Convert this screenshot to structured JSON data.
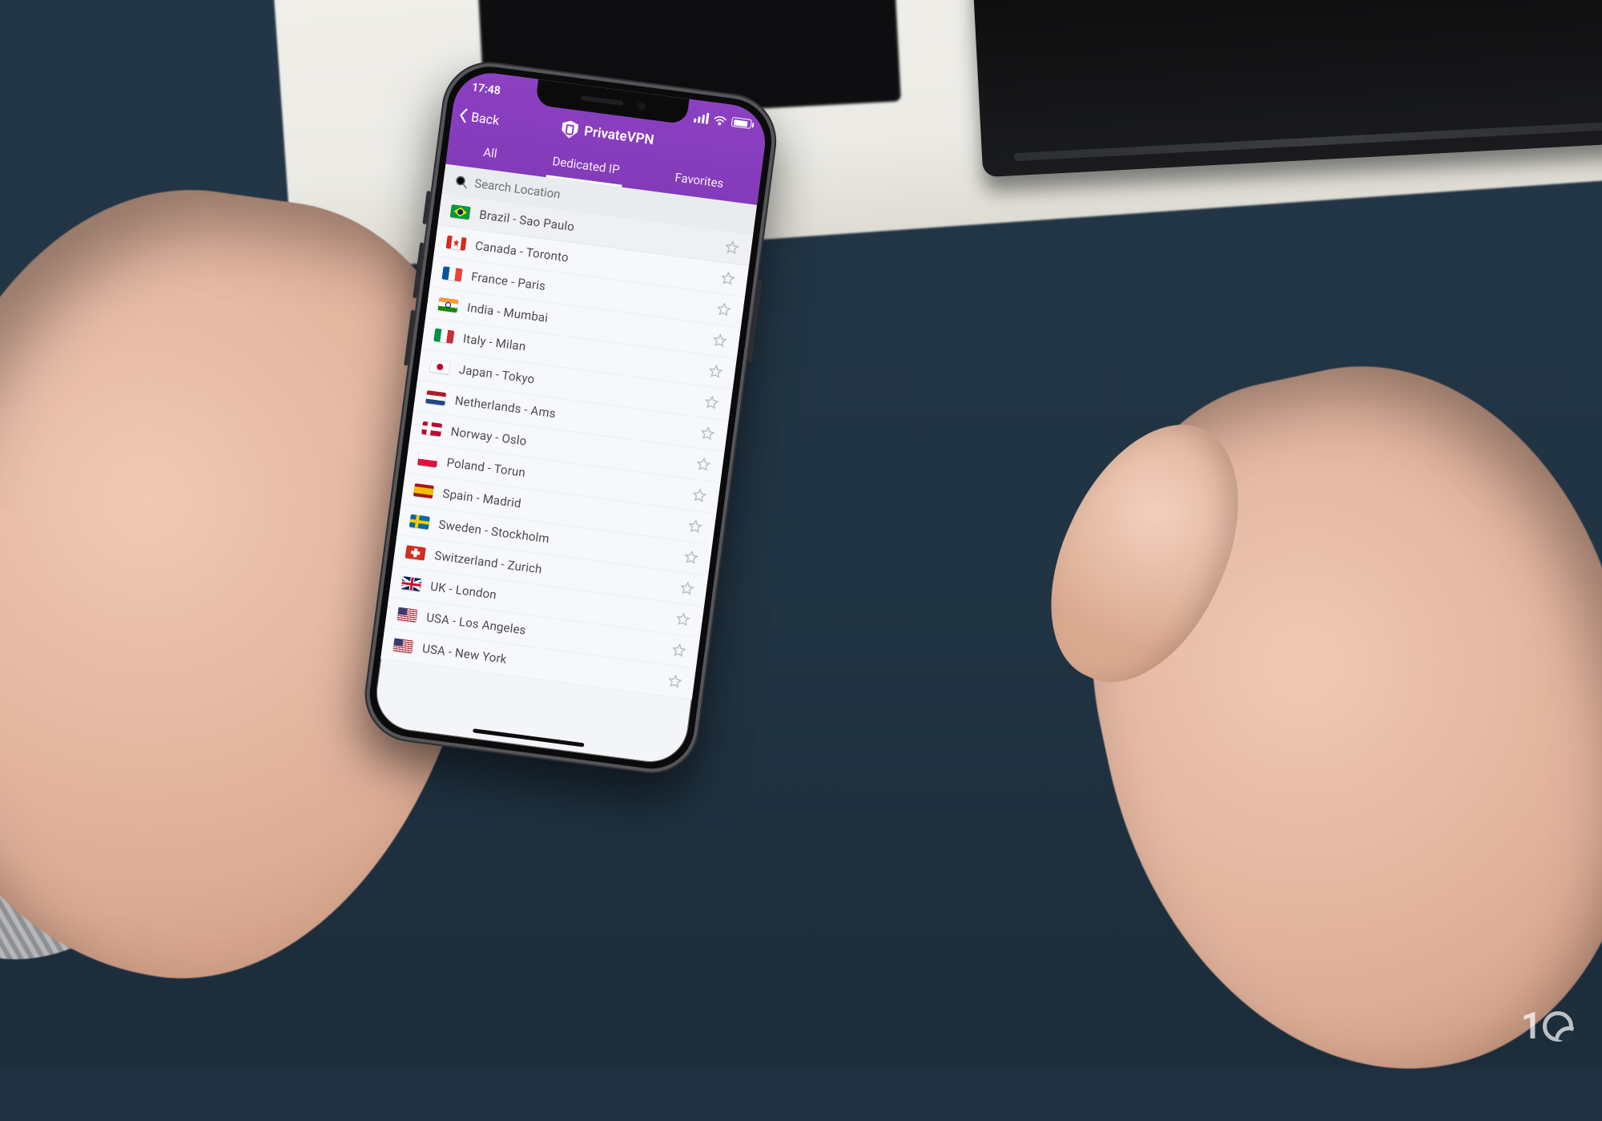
{
  "status_bar": {
    "time": "17:48"
  },
  "header": {
    "back_label": "Back",
    "brand": "PrivateVPN"
  },
  "tabs": {
    "all": "All",
    "dedicated": "Dedicated IP",
    "favorites": "Favorites",
    "active": "dedicated"
  },
  "search": {
    "placeholder": "Search Location"
  },
  "locations": [
    {
      "flag": "br",
      "label": "Brazil - Sao Paulo",
      "selected": true
    },
    {
      "flag": "ca",
      "label": "Canada - Toronto"
    },
    {
      "flag": "fr",
      "label": "France - Paris"
    },
    {
      "flag": "in",
      "label": "India - Mumbai"
    },
    {
      "flag": "it",
      "label": "Italy - Milan"
    },
    {
      "flag": "jp",
      "label": "Japan - Tokyo"
    },
    {
      "flag": "nl",
      "label": "Netherlands - Ams"
    },
    {
      "flag": "no",
      "label": "Norway - Oslo"
    },
    {
      "flag": "pl",
      "label": "Poland - Torun"
    },
    {
      "flag": "es",
      "label": "Spain - Madrid"
    },
    {
      "flag": "se",
      "label": "Sweden - Stockholm"
    },
    {
      "flag": "ch",
      "label": "Switzerland - Zurich"
    },
    {
      "flag": "uk",
      "label": "UK - London"
    },
    {
      "flag": "us",
      "label": "USA - Los Angeles"
    },
    {
      "flag": "us",
      "label": "USA - New York"
    }
  ],
  "watermark": "10"
}
